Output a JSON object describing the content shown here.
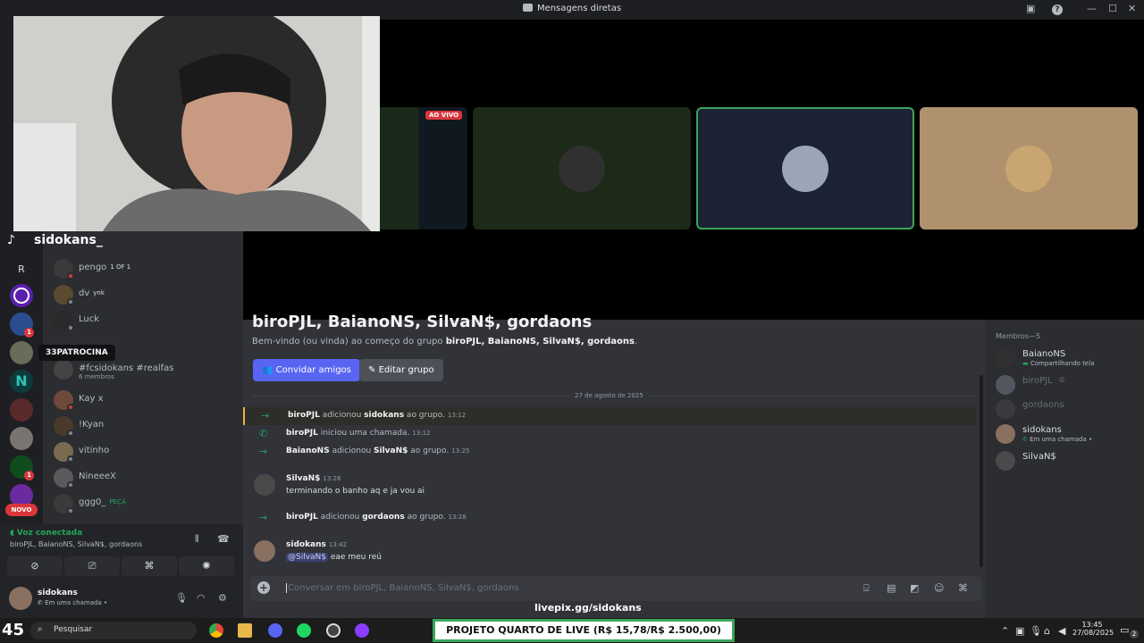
{
  "window": {
    "title": "Mensagens diretas"
  },
  "overlay": {
    "tiktok_handle": "sidokans_",
    "tile_live_badge": "AO VIVO",
    "livepix_url": "livepix.gg/sidokans",
    "goal_banner": "PROJETO QUARTO DE LIVE (R$ 15,78/R$ 2.500,00)",
    "tooltip_server": "33PATROCINA",
    "server_letter": "R",
    "novo_badge": "NOVO",
    "server_badges": [
      "1",
      "1"
    ]
  },
  "dm_list": [
    {
      "name": "pengo",
      "tag": "1 OF 1",
      "status": "#da373c"
    },
    {
      "name": "dv",
      "tag": "ynk",
      "status": "#80848e"
    },
    {
      "name": "Luck",
      "tag": "",
      "status": "#80848e"
    },
    {
      "name": "#fcsidokans #realfas",
      "sub": "6 membros",
      "tag": "",
      "status": ""
    },
    {
      "name": "Kay x",
      "tag": "",
      "status": "#da373c"
    },
    {
      "name": "!Kyan",
      "tag": "",
      "status": "#80848e"
    },
    {
      "name": "vitinho",
      "tag": "",
      "status": "#80848e"
    },
    {
      "name": "NineeeX",
      "tag": "",
      "status": "#80848e"
    },
    {
      "name": "ggg0_",
      "tag": "PEÇA",
      "status": "#80848e"
    }
  ],
  "voice": {
    "status": "Voz conectada",
    "channel": "biroPJL, BaianoNS, SilvaN$, gordaons"
  },
  "user": {
    "name": "sidokans",
    "status": "Em uma chamada •"
  },
  "chat": {
    "title": "biroPJL, BaianoNS, SilvaN$, gordaons",
    "welcome_prefix": "Bem-vindo (ou vinda) ao começo do grupo ",
    "welcome_names": "biroPJL, BaianoNS, SilvaN$, gordaons",
    "invite_btn": "Convidar amigos",
    "edit_btn": "Editar grupo",
    "date_divider": "27 de agosto de 2025",
    "sys": [
      {
        "who": "biroPJL",
        "mid": " adicionou ",
        "target": "sidokans",
        "end": " ao grupo.",
        "time": "13:12",
        "icon": "→"
      },
      {
        "who": "biroPJL",
        "mid": " iniciou uma chamada.",
        "target": "",
        "end": "",
        "time": "13:12",
        "icon": "✆"
      },
      {
        "who": "BaianoNS",
        "mid": " adicionou ",
        "target": "SilvaN$",
        "end": " ao grupo.",
        "time": "13:25",
        "icon": "→"
      }
    ],
    "msg1": {
      "author": "SilvaN$",
      "time": "13:26",
      "text": "terminando o banho aq e ja vou ai"
    },
    "sys4": {
      "who": "biroPJL",
      "mid": " adicionou ",
      "target": "gordaons",
      "end": " ao grupo.",
      "time": "13:28"
    },
    "msg2": {
      "author": "sidokans",
      "time": "13:42",
      "mention": "@SilvaN$",
      "text": " eae meu reú"
    },
    "input_placeholder": "Conversar em biroPJL, BaianoNS, SilvaN$, gordaons"
  },
  "members": {
    "header": "Membros—5",
    "list": [
      {
        "name": "BaianoNS",
        "sub": "Compartilhando tela",
        "dim": false
      },
      {
        "name": "biroPJL",
        "sub": "",
        "dim": true
      },
      {
        "name": "gordaons",
        "sub": "",
        "dim": true
      },
      {
        "name": "sidokans",
        "sub": "Em uma chamada •",
        "dim": false
      },
      {
        "name": "SilvaN$",
        "sub": "",
        "dim": false
      }
    ]
  },
  "taskbar": {
    "search": "Pesquisar",
    "time": "13:45",
    "date": "27/08/2025",
    "weather": "45",
    "notif_count": "2"
  },
  "colors": {
    "accent": "#5865f2",
    "green": "#23a55a",
    "red": "#da373c"
  }
}
